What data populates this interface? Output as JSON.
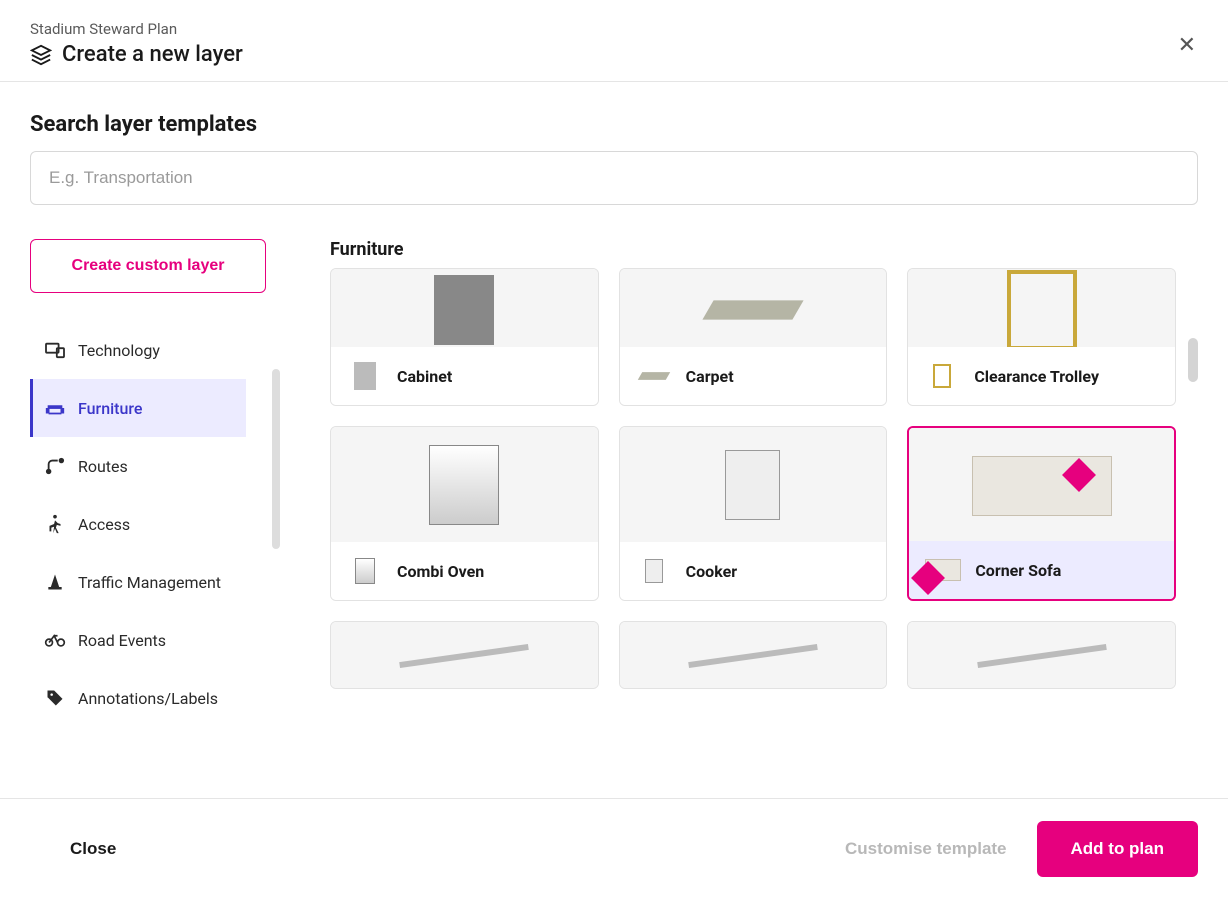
{
  "header": {
    "breadcrumb": "Stadium Steward Plan",
    "title": "Create a new layer"
  },
  "search": {
    "label": "Search layer templates",
    "placeholder": "E.g. Transportation",
    "value": ""
  },
  "sidebar": {
    "custom_button": "Create custom layer",
    "categories": [
      {
        "icon": "devices",
        "label": "Technology",
        "active": false
      },
      {
        "icon": "couch",
        "label": "Furniture",
        "active": true
      },
      {
        "icon": "route",
        "label": "Routes",
        "active": false
      },
      {
        "icon": "walk",
        "label": "Access",
        "active": false
      },
      {
        "icon": "cone",
        "label": "Traffic Management",
        "active": false
      },
      {
        "icon": "bike",
        "label": "Road Events",
        "active": false
      },
      {
        "icon": "tag",
        "label": "Annotations/Labels",
        "active": false
      }
    ]
  },
  "main": {
    "section_title": "Furniture",
    "cards": [
      {
        "label": "Cabinet",
        "selected": false,
        "row": "first"
      },
      {
        "label": "Carpet",
        "selected": false,
        "row": "first"
      },
      {
        "label": "Clearance Trolley",
        "selected": false,
        "row": "first"
      },
      {
        "label": "Combi Oven",
        "selected": false,
        "row": "mid"
      },
      {
        "label": "Cooker",
        "selected": false,
        "row": "mid"
      },
      {
        "label": "Corner Sofa",
        "selected": true,
        "row": "mid"
      },
      {
        "label": "",
        "selected": false,
        "row": "partial"
      },
      {
        "label": "",
        "selected": false,
        "row": "partial"
      },
      {
        "label": "",
        "selected": false,
        "row": "partial"
      }
    ]
  },
  "footer": {
    "close": "Close",
    "customise": "Customise template",
    "add": "Add to plan"
  }
}
